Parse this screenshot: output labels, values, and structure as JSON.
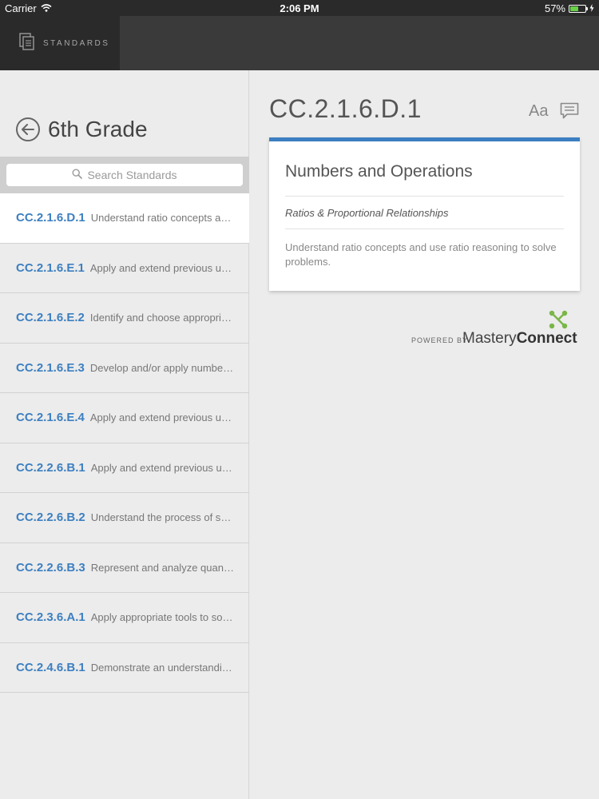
{
  "status": {
    "carrier": "Carrier",
    "time": "2:06 PM",
    "battery": "57%",
    "battery_level": 0.57
  },
  "nav": {
    "tab_label": "STANDARDS"
  },
  "left": {
    "grade_title": "6th Grade",
    "search_placeholder": "Search Standards",
    "standards": [
      {
        "code": "CC.2.1.6.D.1",
        "desc": "Understand ratio concepts and use ratio reasoning to solve problems.",
        "selected": true
      },
      {
        "code": "CC.2.1.6.E.1",
        "desc": "Apply and extend previous understandings of multiplication and division."
      },
      {
        "code": "CC.2.1.6.E.2",
        "desc": "Identify and choose appropriate processes to compute fluently with multi-digit numbers."
      },
      {
        "code": "CC.2.1.6.E.3",
        "desc": "Develop and/or apply number theory concepts to find common factors and multiples."
      },
      {
        "code": "CC.2.1.6.E.4",
        "desc": "Apply and extend previous understandings of numbers to the system of rational numbers."
      },
      {
        "code": "CC.2.2.6.B.1",
        "desc": "Apply and extend previous understandings of arithmetic to algebraic expressions."
      },
      {
        "code": "CC.2.2.6.B.2",
        "desc": "Understand the process of solving a one-variable equation or inequality."
      },
      {
        "code": "CC.2.2.6.B.3",
        "desc": "Represent and analyze quantitative relationships between dependent and independent variables."
      },
      {
        "code": "CC.2.3.6.A.1",
        "desc": "Apply appropriate tools to solve real-world and mathematical problems."
      },
      {
        "code": "CC.2.4.6.B.1",
        "desc": "Demonstrate an understanding of statistical variability."
      }
    ]
  },
  "detail": {
    "code": "CC.2.1.6.D.1",
    "font_button": "Aa",
    "card": {
      "title": "Numbers and Operations",
      "subtitle": "Ratios & Proportional Relationships",
      "description": "Understand ratio concepts and use ratio reasoning to solve problems."
    },
    "powered_by": "POWERED BY",
    "brand_light": "Mastery",
    "brand_bold": "Connect"
  },
  "colors": {
    "accent": "#3c7fc1",
    "nav_bg": "#3a3a3a",
    "nav_tab_bg": "#2a2a2a",
    "brand_green": "#7ab648"
  },
  "icons": [
    "wifi-icon",
    "battery-icon",
    "charging-icon",
    "standards-doc-icon",
    "back-arrow-icon",
    "search-icon",
    "font-size-icon",
    "comment-icon",
    "masteryconnect-logo-icon"
  ]
}
